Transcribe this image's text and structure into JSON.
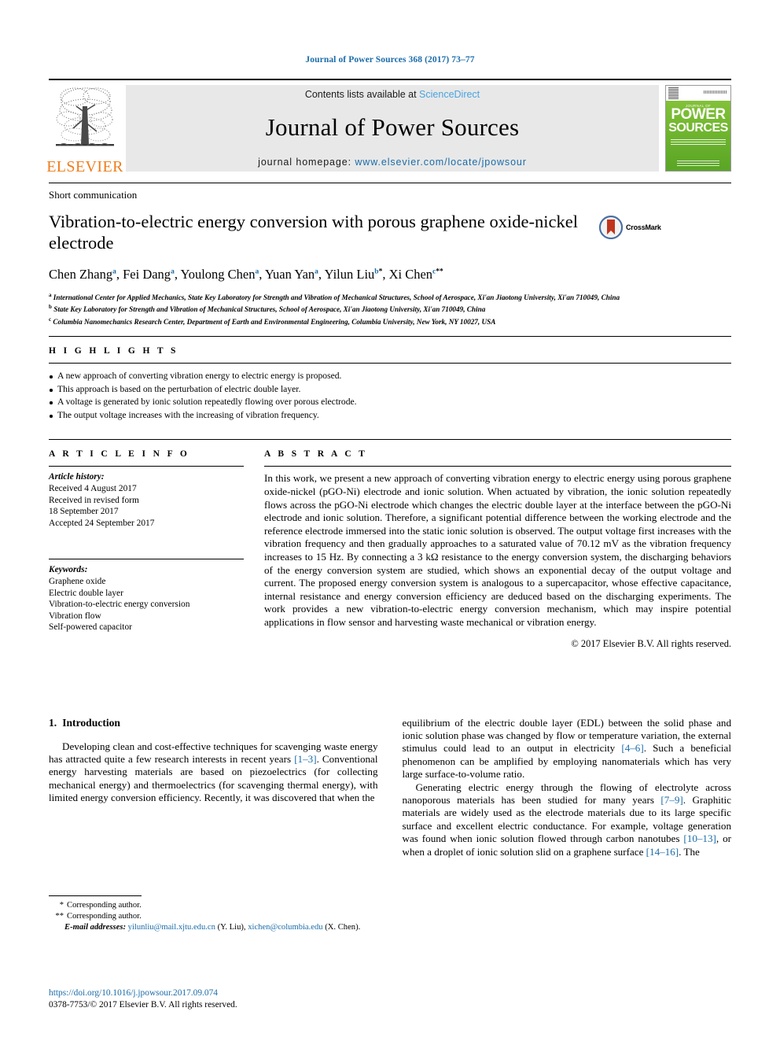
{
  "running_head": "Journal of Power Sources 368 (2017) 73–77",
  "masthead": {
    "publisher_name": "ELSEVIER",
    "contents_prefix": "Contents lists available at ",
    "contents_link": "ScienceDirect",
    "journal_name": "Journal of Power Sources",
    "homepage_prefix": "journal homepage: ",
    "homepage_url": "www.elsevier.com/locate/jpowsour",
    "cover": {
      "kicker": "JOURNAL OF",
      "title_line1": "POWER",
      "title_line2": "SOURCES"
    }
  },
  "article": {
    "type": "Short communication",
    "title": "Vibration-to-electric energy conversion with porous graphene oxide-nickel electrode",
    "crossmark_label": "CrossMark",
    "authors": [
      {
        "name": "Chen Zhang",
        "marks": "a"
      },
      {
        "name": "Fei Dang",
        "marks": "a"
      },
      {
        "name": "Youlong Chen",
        "marks": "a"
      },
      {
        "name": "Yuan Yan",
        "marks": "a"
      },
      {
        "name": "Yilun Liu",
        "marks": "b",
        "star": "*"
      },
      {
        "name": "Xi Chen",
        "marks": "c",
        "star": "**"
      }
    ],
    "affiliations": [
      {
        "mark": "a",
        "text": "International Center for Applied Mechanics, State Key Laboratory for Strength and Vibration of Mechanical Structures, School of Aerospace, Xi'an Jiaotong University, Xi'an 710049, China"
      },
      {
        "mark": "b",
        "text": "State Key Laboratory for Strength and Vibration of Mechanical Structures, School of Aerospace, Xi'an Jiaotong University, Xi'an 710049, China"
      },
      {
        "mark": "c",
        "text": "Columbia Nanomechanics Research Center, Department of Earth and Environmental Engineering, Columbia University, New York, NY 10027, USA"
      }
    ]
  },
  "highlights": {
    "heading": "H I G H L I G H T S",
    "items": [
      "A new approach of converting vibration energy to electric energy is proposed.",
      "This approach is based on the perturbation of electric double layer.",
      "A voltage is generated by ionic solution repeatedly flowing over porous electrode.",
      "The output voltage increases with the increasing of vibration frequency."
    ]
  },
  "article_info": {
    "heading": "A R T I C L E   I N F O",
    "history_label": "Article history:",
    "history_lines": [
      "Received 4 August 2017",
      "Received in revised form",
      "18 September 2017",
      "Accepted 24 September 2017"
    ],
    "keywords_label": "Keywords:",
    "keywords": [
      "Graphene oxide",
      "Electric double layer",
      "Vibration-to-electric energy conversion",
      "Vibration flow",
      "Self-powered capacitor"
    ]
  },
  "abstract": {
    "heading": "A B S T R A C T",
    "text": "In this work, we present a new approach of converting vibration energy to electric energy using porous graphene oxide-nickel (pGO-Ni) electrode and ionic solution. When actuated by vibration, the ionic solution repeatedly flows across the pGO-Ni electrode which changes the electric double layer at the interface between the pGO-Ni electrode and ionic solution. Therefore, a significant potential difference between the working electrode and the reference electrode immersed into the static ionic solution is observed. The output voltage first increases with the vibration frequency and then gradually approaches to a saturated value of 70.12 mV as the vibration frequency increases to 15 Hz. By connecting a 3 kΩ resistance to the energy conversion system, the discharging behaviors of the energy conversion system are studied, which shows an exponential decay of the output voltage and current. The proposed energy conversion system is analogous to a supercapacitor, whose effective capacitance, internal resistance and energy conversion efficiency are deduced based on the discharging experiments. The work provides a new vibration-to-electric energy conversion mechanism, which may inspire potential applications in flow sensor and harvesting waste mechanical or vibration energy.",
    "copyright": "© 2017 Elsevier B.V. All rights reserved."
  },
  "body": {
    "section_number": "1.",
    "section_title": "Introduction",
    "left_paragraph_1_a": "Developing clean and cost-effective techniques for scavenging waste energy has attracted quite a few research interests in recent years ",
    "left_ref_1": "[1–3]",
    "left_paragraph_1_b": ". Conventional energy harvesting materials are based on piezoelectrics (for collecting mechanical energy) and thermoelectrics (for scavenging thermal energy), with limited energy conversion efficiency. Recently, it was discovered that when the",
    "right_paragraph_1_a": "equilibrium of the electric double layer (EDL) between the solid phase and ionic solution phase was changed by flow or temperature variation, the external stimulus could lead to an output in electricity ",
    "right_ref_1": "[4–6]",
    "right_paragraph_1_b": ". Such a beneficial phenomenon can be amplified by employing nanomaterials which has very large surface-to-volume ratio.",
    "right_paragraph_2_a": "Generating electric energy through the flowing of electrolyte across nanoporous materials has been studied for many years ",
    "right_ref_2": "[7–9]",
    "right_paragraph_2_b": ". Graphitic materials are widely used as the electrode materials due to its large specific surface and excellent electric conductance. For example, voltage generation was found when ionic solution flowed through carbon nanotubes ",
    "right_ref_3": "[10–13]",
    "right_paragraph_2_c": ", or when a droplet of ionic solution slid on a graphene surface ",
    "right_ref_4": "[14–16]",
    "right_paragraph_2_d": ". The"
  },
  "footnotes": {
    "corresponding_1_mark": "*",
    "corresponding_1": "Corresponding author.",
    "corresponding_2_mark": "**",
    "corresponding_2": "Corresponding author.",
    "email_label": "E-mail addresses:",
    "email_1": "yilunliu@mail.xjtu.edu.cn",
    "email_1_owner": "(Y. Liu)",
    "email_2": "xichen@columbia.edu",
    "email_2_owner": "(X. Chen)."
  },
  "footer": {
    "doi": "https://doi.org/10.1016/j.jpowsour.2017.09.074",
    "issn_line": "0378-7753/© 2017 Elsevier B.V. All rights reserved."
  },
  "colors": {
    "link_blue": "#1b6ca8",
    "sciencedirect_blue": "#4aa3df",
    "elsevier_orange": "#ef7d1a",
    "cover_green": "#6fb52e"
  }
}
